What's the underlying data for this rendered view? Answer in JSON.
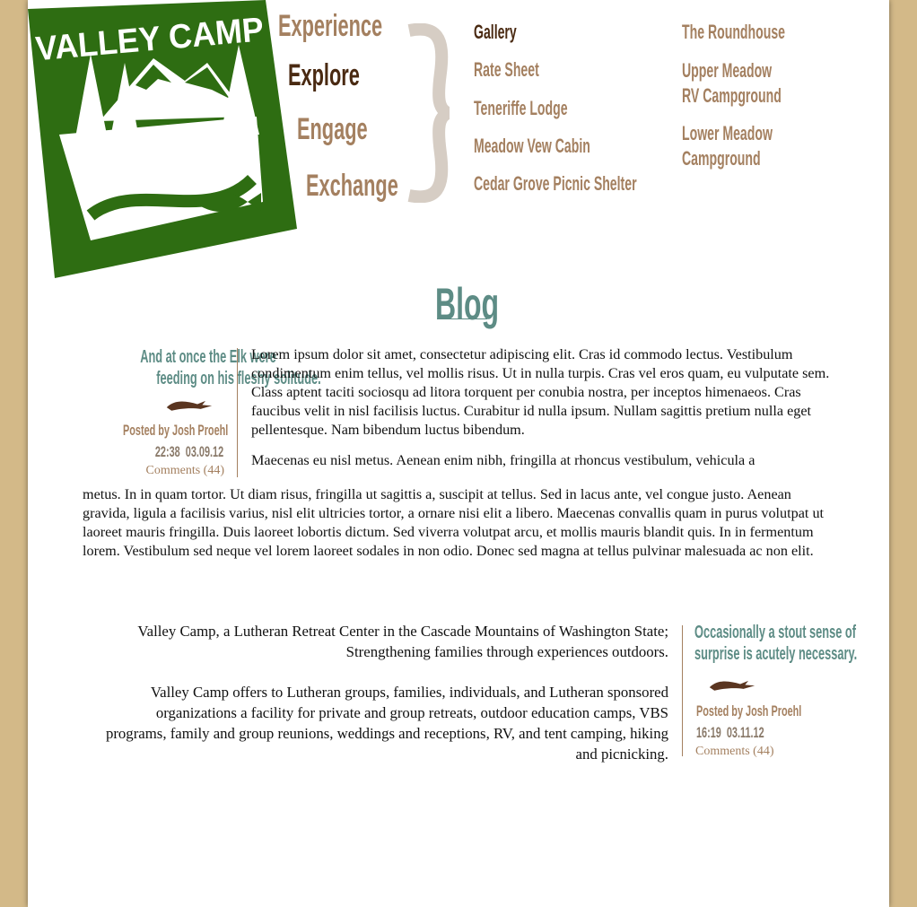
{
  "logo": {
    "text": "VALLEY CAMP",
    "brand_color": "#2e6d12"
  },
  "main_nav": [
    {
      "label": "Experience",
      "active": false
    },
    {
      "label": "Explore",
      "active": true
    },
    {
      "label": "Engage",
      "active": false
    },
    {
      "label": "Exchange",
      "active": false
    }
  ],
  "sub_nav_col1": [
    {
      "label": "Gallery",
      "active": true
    },
    {
      "label": "Rate Sheet"
    },
    {
      "label": "Teneriffe Lodge"
    },
    {
      "label": "Meadow Vew Cabin"
    },
    {
      "label": "Cedar Grove Picnic Shelter"
    }
  ],
  "sub_nav_col2": [
    {
      "label": "The Roundhouse"
    },
    {
      "label_line1": "Upper Meadow",
      "label_line2": "RV Campground"
    },
    {
      "label_line1": "Lower Meadow",
      "label_line2": "Campground"
    }
  ],
  "blog": {
    "title": "Blog",
    "post1": {
      "quote_line1": "And at once the Elk were",
      "quote_line2": "feeding on his fleshy solitude.",
      "posted_prefix": "Posted by",
      "author": "Josh Proehl",
      "time": "22:38",
      "date": "03.09.12",
      "comments": "Comments (44)",
      "para1": "Lorem ipsum dolor sit amet, consectetur adipiscing elit. Cras id commodo lectus. Vestibulum condimentum enim tellus, vel mollis risus. Ut in nulla turpis. Cras vel eros quam, eu vulputate sem. Class aptent taciti sociosqu ad litora torquent per conubia nostra, per inceptos himenaeos. Cras faucibus velit in nisl facilisis luctus. Curabitur id nulla ipsum. Nullam sagittis pretium nulla eget pellentesque. Nam bibendum luctus bibendum.",
      "para2_start": "Maecenas eu nisl metus. Aenean enim nibh, fringilla at rhoncus vestibulum, vehicula a",
      "para2_rest": "metus. In in quam tortor. Ut diam risus, fringilla ut sagittis a, suscipit at tellus. Sed in lacus ante, vel congue justo. Aenean gravida, ligula a facilisis varius, nisl elit ultricies tortor, a ornare nisi elit a libero. Maecenas convallis quam in purus volutpat ut laoreet mauris fringilla. Duis laoreet lobortis dictum. Sed viverra volutpat arcu, et mollis mauris blandit quis. In in fermentum lorem. Vestibulum sed neque vel lorem laoreet sodales in non odio. Donec sed magna at tellus pulvinar malesuada ac non elit."
    },
    "post2": {
      "quote_line1": "Occasionally a stout sense of",
      "quote_line2": "surprise is acutely necessary.",
      "posted_prefix": "Posted by",
      "author": "Josh Proehl",
      "time": "16:19",
      "date": "03.11.12",
      "comments": "Comments (44)"
    }
  },
  "about": {
    "para1": "Valley Camp, a Lutheran Retreat Center in the Cascade Mountains of Washington State; Strengthening families through experiences outdoors.",
    "para2": "Valley Camp offers to Lutheran groups, families, individuals, and Lutheran sponsored organizations a facility for private and group retreats, outdoor education camps, VBS programs, family and group reunions, weddings and receptions, RV, and tent camping, hiking and picnicking."
  }
}
